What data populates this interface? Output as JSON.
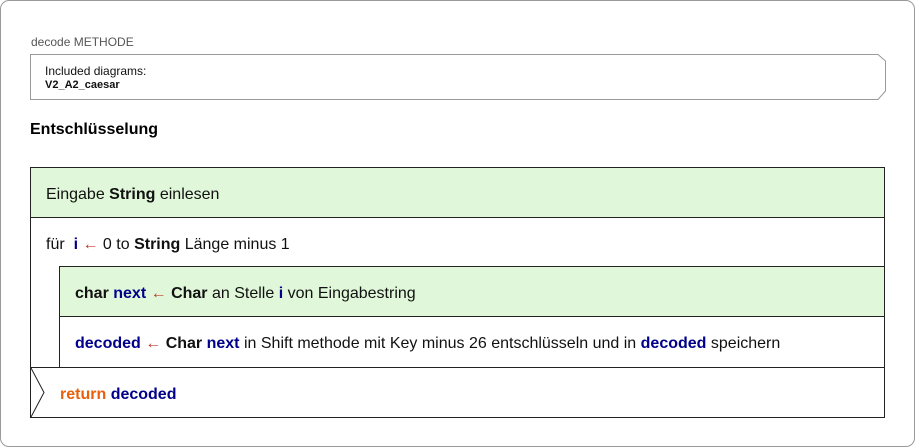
{
  "method_label": "decode METHODE",
  "included": {
    "title": "Included diagrams:",
    "name": "V2_A2_caesar"
  },
  "heading": "Entschlüsselung",
  "steps": {
    "input": {
      "prefix": "Eingabe",
      "type": "String",
      "suffix": "einlesen"
    },
    "loop": {
      "keyword": "für",
      "var": "i",
      "arrow": "←",
      "from": "0 to",
      "type": "String",
      "suffix": "Länge minus 1"
    },
    "char_stmt": {
      "type": "char",
      "var": "next",
      "arrow": "←",
      "type2": "Char",
      "mid": "an Stelle",
      "var2": "i",
      "suffix": "von Eingabestring"
    },
    "decode_stmt": {
      "var": "decoded",
      "arrow": "←",
      "type": "Char",
      "var2": "next",
      "mid": "in Shift methode mit Key minus 26 entschlüsseln und in",
      "var3": "decoded",
      "suffix": "speichern"
    },
    "return_stmt": {
      "keyword": "return",
      "var": "decoded"
    }
  },
  "colors": {
    "green_fill": "#e0f7d9",
    "variable": "#00008b",
    "arrow": "#c0392b",
    "return": "#e8600c"
  }
}
